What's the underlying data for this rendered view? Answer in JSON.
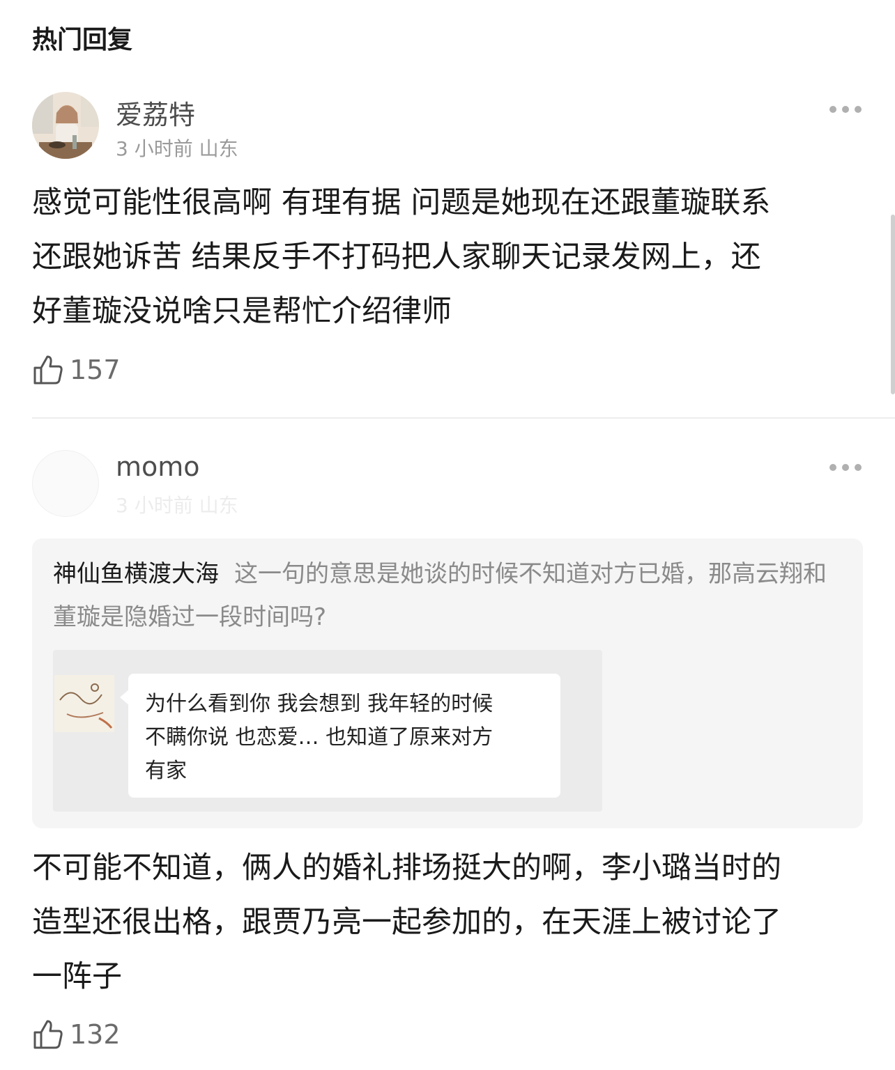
{
  "section": {
    "title": "热门回复"
  },
  "comments": [
    {
      "username": "爱荔特",
      "meta": "3 小时前 山东",
      "text_lines": [
        "感觉可能性很高啊 有理有据 问题是她现在还跟董璇联系",
        "还跟她诉苦 结果反手不打码把人家聊天记录发网上，还",
        "好董璇没说啥只是帮忙介绍律师"
      ],
      "likes": "157"
    },
    {
      "username": "momo",
      "meta": "3 小时前 山东",
      "quote": {
        "author": "神仙鱼横渡大海",
        "text": "这一句的意思是她谈的时候不知道对方已婚，那高云翔和董璇是隐婚过一段时间吗?",
        "image_text_lines": [
          "为什么看到你 我会想到 我年轻的时候",
          "不瞒你说 也恋爱… 也知道了原来对方",
          "有家"
        ]
      },
      "text_lines": [
        "不可能不知道，俩人的婚礼排场挺大的啊，李小璐当时的",
        "造型还很出格，跟贾乃亮一起参加的，在天涯上被讨论了",
        "一阵子"
      ],
      "likes": "132"
    }
  ],
  "icons": {
    "like": "thumbs-up-icon",
    "more": "more-icon"
  },
  "colors": {
    "text": "#1a1a1a",
    "meta": "#9a9a9a",
    "quote_bg": "#f5f5f5"
  }
}
